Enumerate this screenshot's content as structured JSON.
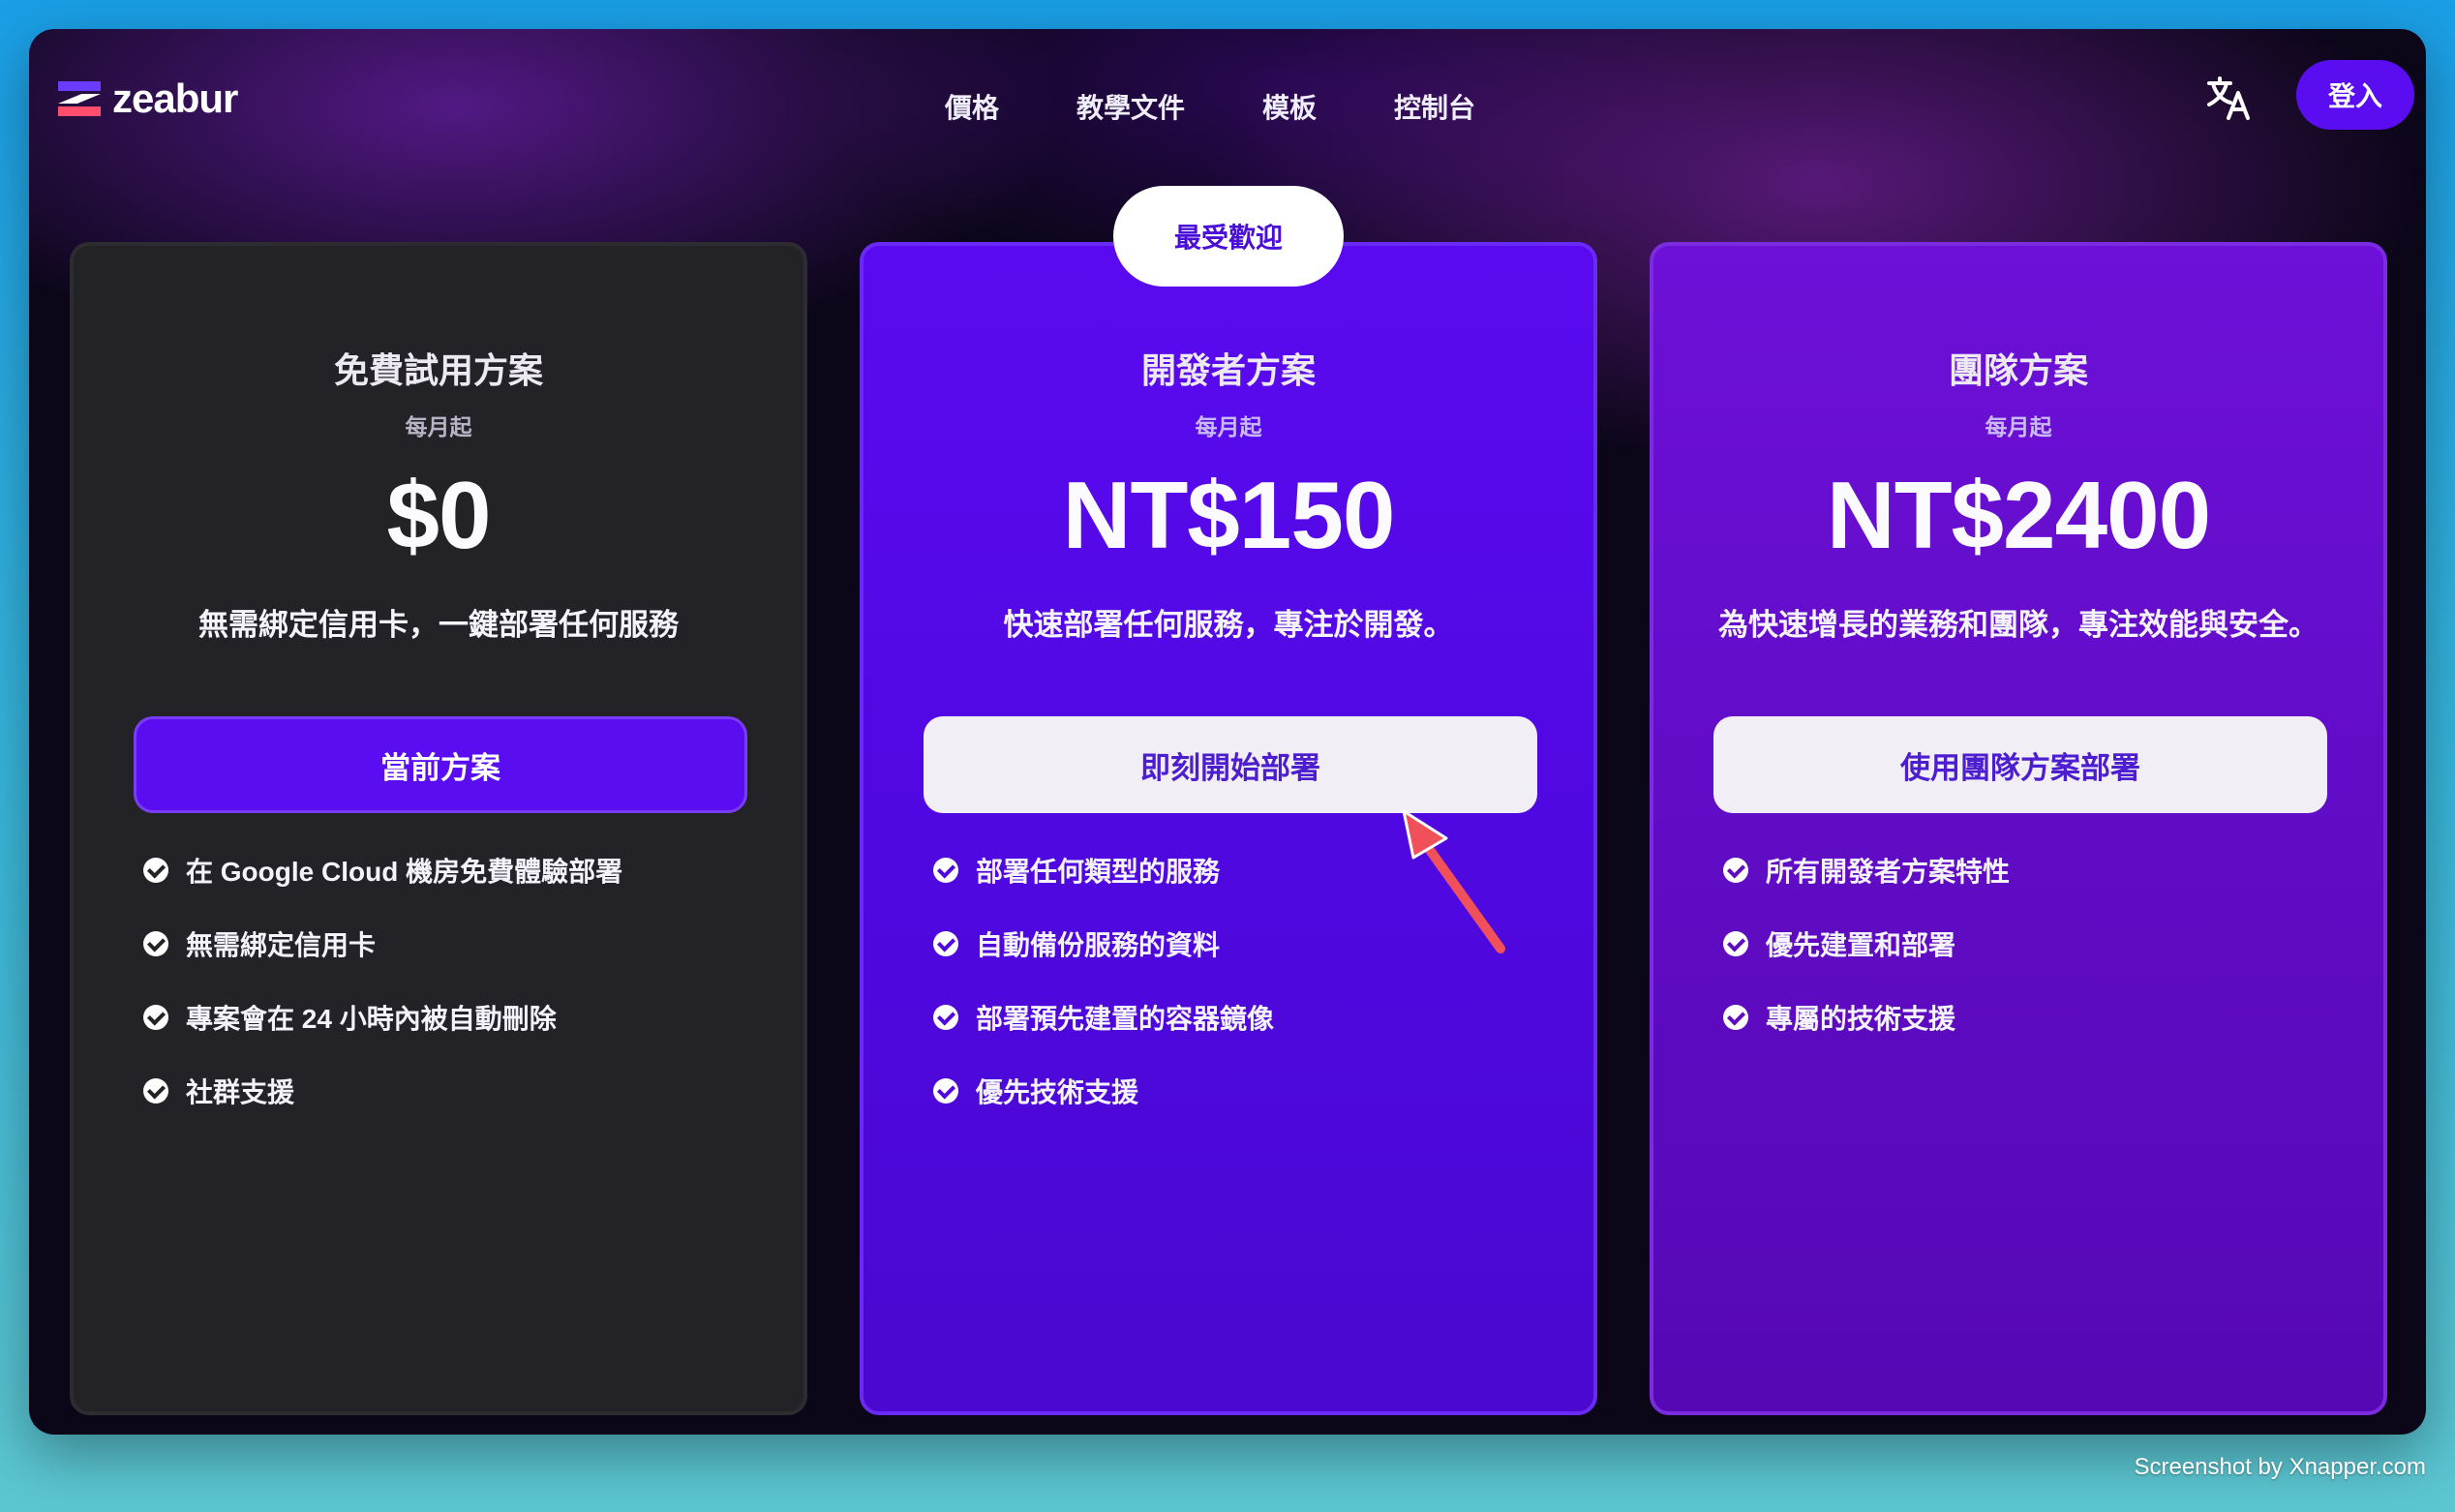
{
  "header": {
    "logo_text": "zeabur",
    "nav": [
      {
        "label": "價格"
      },
      {
        "label": "教學文件"
      },
      {
        "label": "模板"
      },
      {
        "label": "控制台"
      }
    ],
    "language_icon": "translate-icon",
    "login_label": "登入"
  },
  "badge": "最受歡迎",
  "plans": [
    {
      "title": "免費試用方案",
      "subtitle": "每月起",
      "price": "$0",
      "description": "無需綁定信用卡，一鍵部署任何服務",
      "cta": "當前方案",
      "features": [
        "在 Google Cloud 機房免費體驗部署",
        "無需綁定信用卡",
        "專案會在 24 小時內被自動刪除",
        "社群支援"
      ]
    },
    {
      "title": "開發者方案",
      "subtitle": "每月起",
      "price": "NT$150",
      "description": "快速部署任何服務，專注於開發。",
      "cta": "即刻開始部署",
      "features": [
        "部署任何類型的服務",
        "自動備份服務的資料",
        "部署預先建置的容器鏡像",
        "優先技術支援"
      ]
    },
    {
      "title": "團隊方案",
      "subtitle": "每月起",
      "price": "NT$2400",
      "description": "為快速增長的業務和團隊，專注效能與安全。",
      "cta": "使用團隊方案部署",
      "features": [
        "所有開發者方案特性",
        "優先建置和部署",
        "專屬的技術支援"
      ]
    }
  ],
  "colors": {
    "accent": "#5b0df2",
    "arrow": "#f0505a",
    "check": "#ffffff"
  },
  "credit": "Screenshot by Xnapper.com"
}
